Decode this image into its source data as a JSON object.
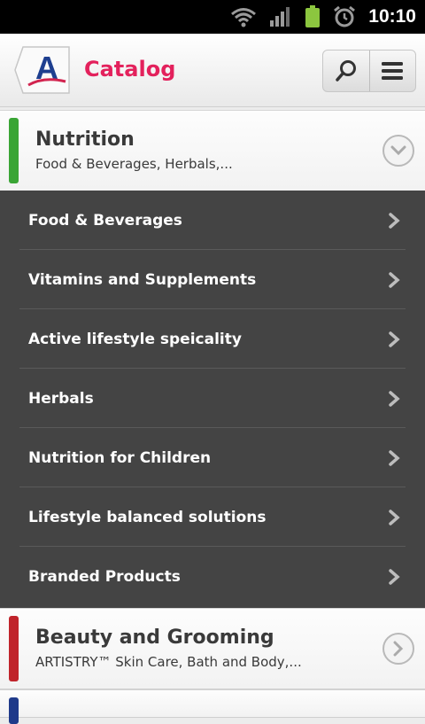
{
  "status_bar": {
    "time": "10:10",
    "icons": [
      "wifi-icon",
      "signal-icon",
      "battery-icon",
      "alarm-icon"
    ],
    "battery_color": "#8cc63f"
  },
  "header": {
    "title": "Catalog",
    "logo_letter": "A",
    "actions": [
      "search-icon",
      "menu-icon"
    ],
    "accent_color": "#e3215c"
  },
  "categories": [
    {
      "name": "Nutrition",
      "subtitle": "Food & Beverages, Herbals,...",
      "color": "#3aa535",
      "expanded": true,
      "items": [
        {
          "label": "Food & Beverages"
        },
        {
          "label": "Vitamins and Supplements"
        },
        {
          "label": "Active lifestyle speicality"
        },
        {
          "label": "Herbals"
        },
        {
          "label": "Nutrition for Children"
        },
        {
          "label": "Lifestyle balanced solutions"
        },
        {
          "label": "Branded Products"
        }
      ]
    },
    {
      "name": "Beauty and Grooming",
      "subtitle": "ARTISTRY™ Skin Care, Bath and Body,...",
      "color": "#c0242b",
      "expanded": false
    },
    {
      "color": "#1f3a8a"
    }
  ]
}
